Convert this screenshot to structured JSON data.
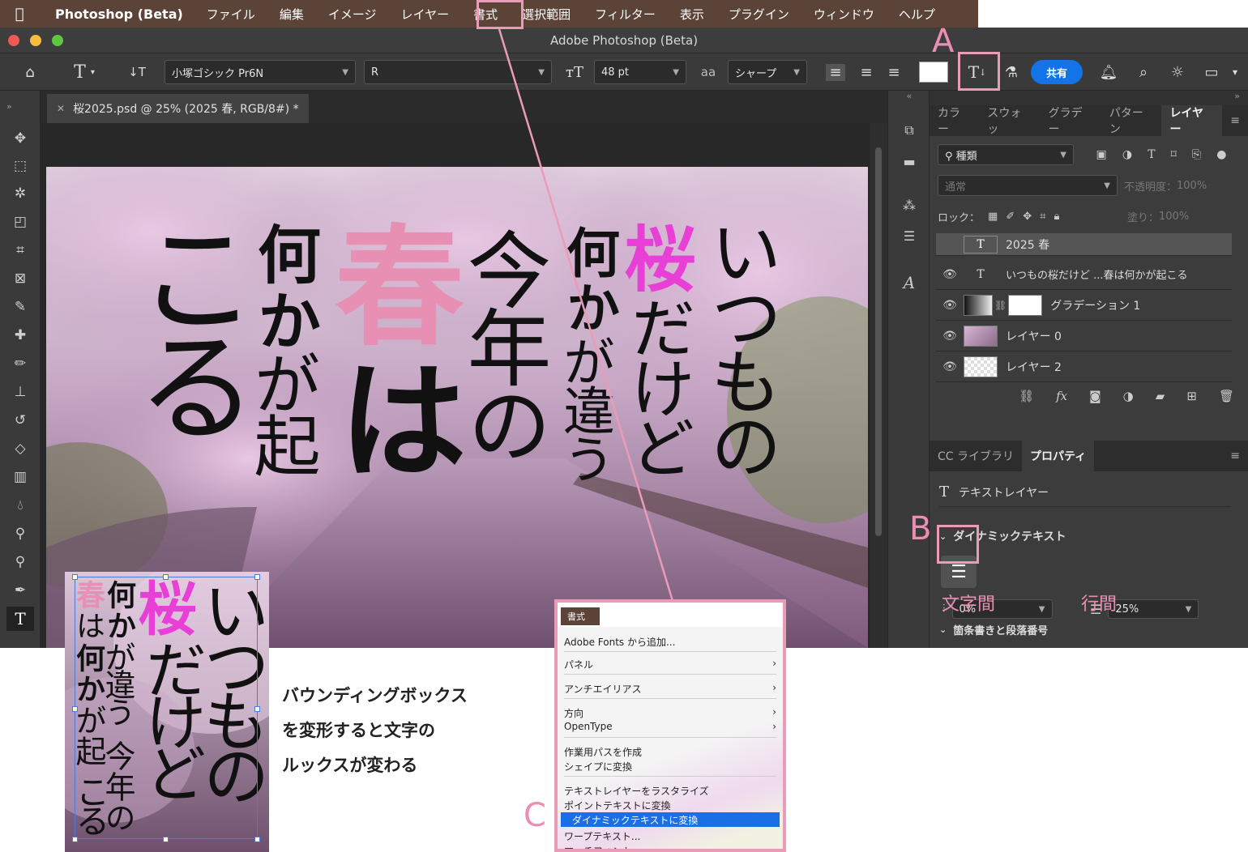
{
  "menubar": {
    "app": "Photoshop (Beta)",
    "items": [
      "ファイル",
      "編集",
      "イメージ",
      "レイヤー",
      "書式",
      "選択範囲",
      "フィルター",
      "表示",
      "プラグイン",
      "ウィンドウ",
      "ヘルプ"
    ]
  },
  "window": {
    "title": "Adobe Photoshop (Beta)"
  },
  "options": {
    "font_family": "小塚ゴシック Pr6N",
    "font_style": "R",
    "font_size": "48 pt",
    "aa_icon": "aa",
    "antialias": "シャープ",
    "share_label": "共有"
  },
  "document": {
    "tab_label": "桜2025.psd @ 25% (2025 春, RGB/8#) *"
  },
  "canvas_text": {
    "col1": "いつもの",
    "col2_pink": "桜",
    "col2": "だけど",
    "col3a": "何",
    "col3b": "か",
    "col3c": "が違う",
    "col4": "今年の",
    "col5_pink": "春",
    "col5": "は",
    "col6a": "何",
    "col6b": "か",
    "col6c": "が起",
    "col7": "こる"
  },
  "layers_panel": {
    "tabs": [
      "カラー",
      "スウォッ",
      "グラデー",
      "パターン",
      "レイヤー"
    ],
    "filter_label": "種類",
    "blend_mode": "通常",
    "opacity_label": "不透明度：",
    "opacity_value": "100%",
    "lock_label": "ロック：",
    "fill_label": "塗り：",
    "fill_value": "100%",
    "layers": [
      {
        "name": "2025 春",
        "type": "text"
      },
      {
        "name": "いつもの桜だけど ...春は何かが起こる",
        "type": "text"
      },
      {
        "name": "グラデーション 1",
        "type": "gradient"
      },
      {
        "name": "レイヤー 0",
        "type": "photo"
      },
      {
        "name": "レイヤー 2",
        "type": "empty"
      }
    ]
  },
  "properties_panel": {
    "tabs": [
      "CC ライブラリ",
      "プロパティ"
    ],
    "kind": "テキストレイヤー",
    "section": "ダイナミックテキスト",
    "tracking_value": "0%",
    "leading_value": "25%",
    "next_section": "箇条書きと段落番号"
  },
  "annotations": {
    "A": "A",
    "B": "B",
    "C": "C",
    "tracking": "文字間",
    "leading": "行間",
    "caption": [
      "バウンディングボックス",
      "を変形すると文字の",
      "ルックスが変わる"
    ]
  },
  "inset_text": {
    "col1": "いつもの",
    "col2_pink": "桜",
    "col2": "だけど",
    "col3a": "何",
    "col3b": "か",
    "col3c": "が違う",
    "col4": "今年の",
    "col5_pink": "春",
    "col5": "は",
    "col6a": "何",
    "col6b": "か",
    "col6c": "が起",
    "col7": "こる"
  },
  "context_menu": {
    "header": "書式",
    "items": [
      {
        "label": "Adobe Fonts から追加...",
        "arrow": ""
      },
      {
        "label": "パネル",
        "arrow": "›"
      },
      {
        "label": "アンチエイリアス",
        "arrow": "›"
      },
      {
        "label": "方向",
        "arrow": "›"
      },
      {
        "label": "OpenType",
        "arrow": "›"
      },
      {
        "label": "作業用パスを作成",
        "arrow": ""
      },
      {
        "label": "シェイプに変換",
        "arrow": ""
      },
      {
        "label": "テキストレイヤーをラスタライズ",
        "arrow": ""
      },
      {
        "label": "ポイントテキストに変換",
        "arrow": ""
      },
      {
        "label": "ダイナミックテキストに変換",
        "arrow": ""
      },
      {
        "label": "ワープテキスト...",
        "arrow": ""
      },
      {
        "label": "マッチフォント...",
        "arrow": ""
      }
    ]
  },
  "colors": {
    "pink": "#e88fb4",
    "magenta": "#e83fd6",
    "annotation": "#ea9bb7",
    "share_blue": "#1473e6"
  }
}
